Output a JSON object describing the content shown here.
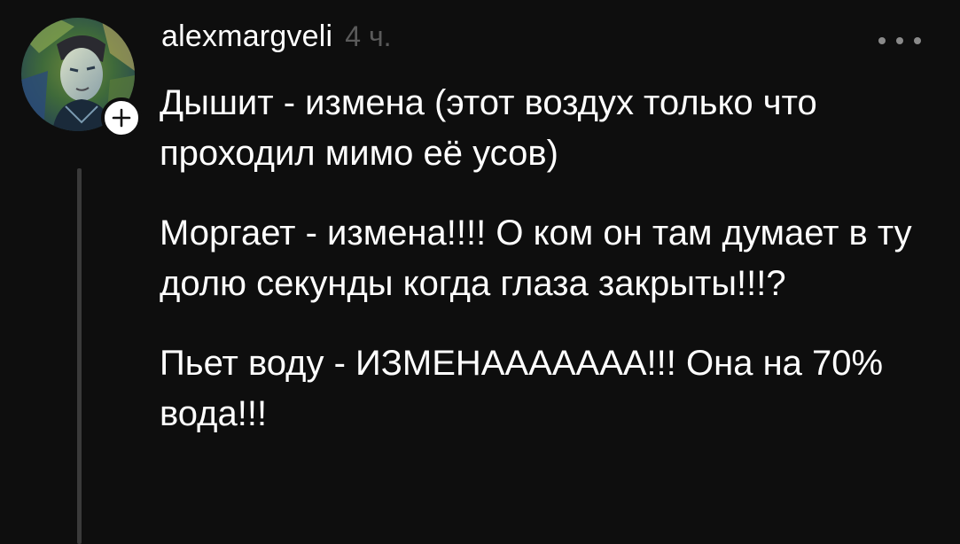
{
  "comment": {
    "username": "alexmargveli",
    "time": "4 ч.",
    "paragraphs": [
      "Дышит - измена (этот воздух только что проходил мимо её усов)",
      "Моргает - измена!!!! О ком он там думает в ту долю секунды когда глаза закрыты!!!?",
      "Пьет воду - ИЗМЕНААААААА!!! Она на 70% вода!!!"
    ]
  },
  "icons": {
    "avatar": "user-avatar",
    "follow": "plus-icon",
    "more": "more-horizontal-icon"
  },
  "colors": {
    "background": "#0e0e0e",
    "text": "#ffffff",
    "muted": "#5a5a5a",
    "thread_line": "#3a3a3a"
  }
}
